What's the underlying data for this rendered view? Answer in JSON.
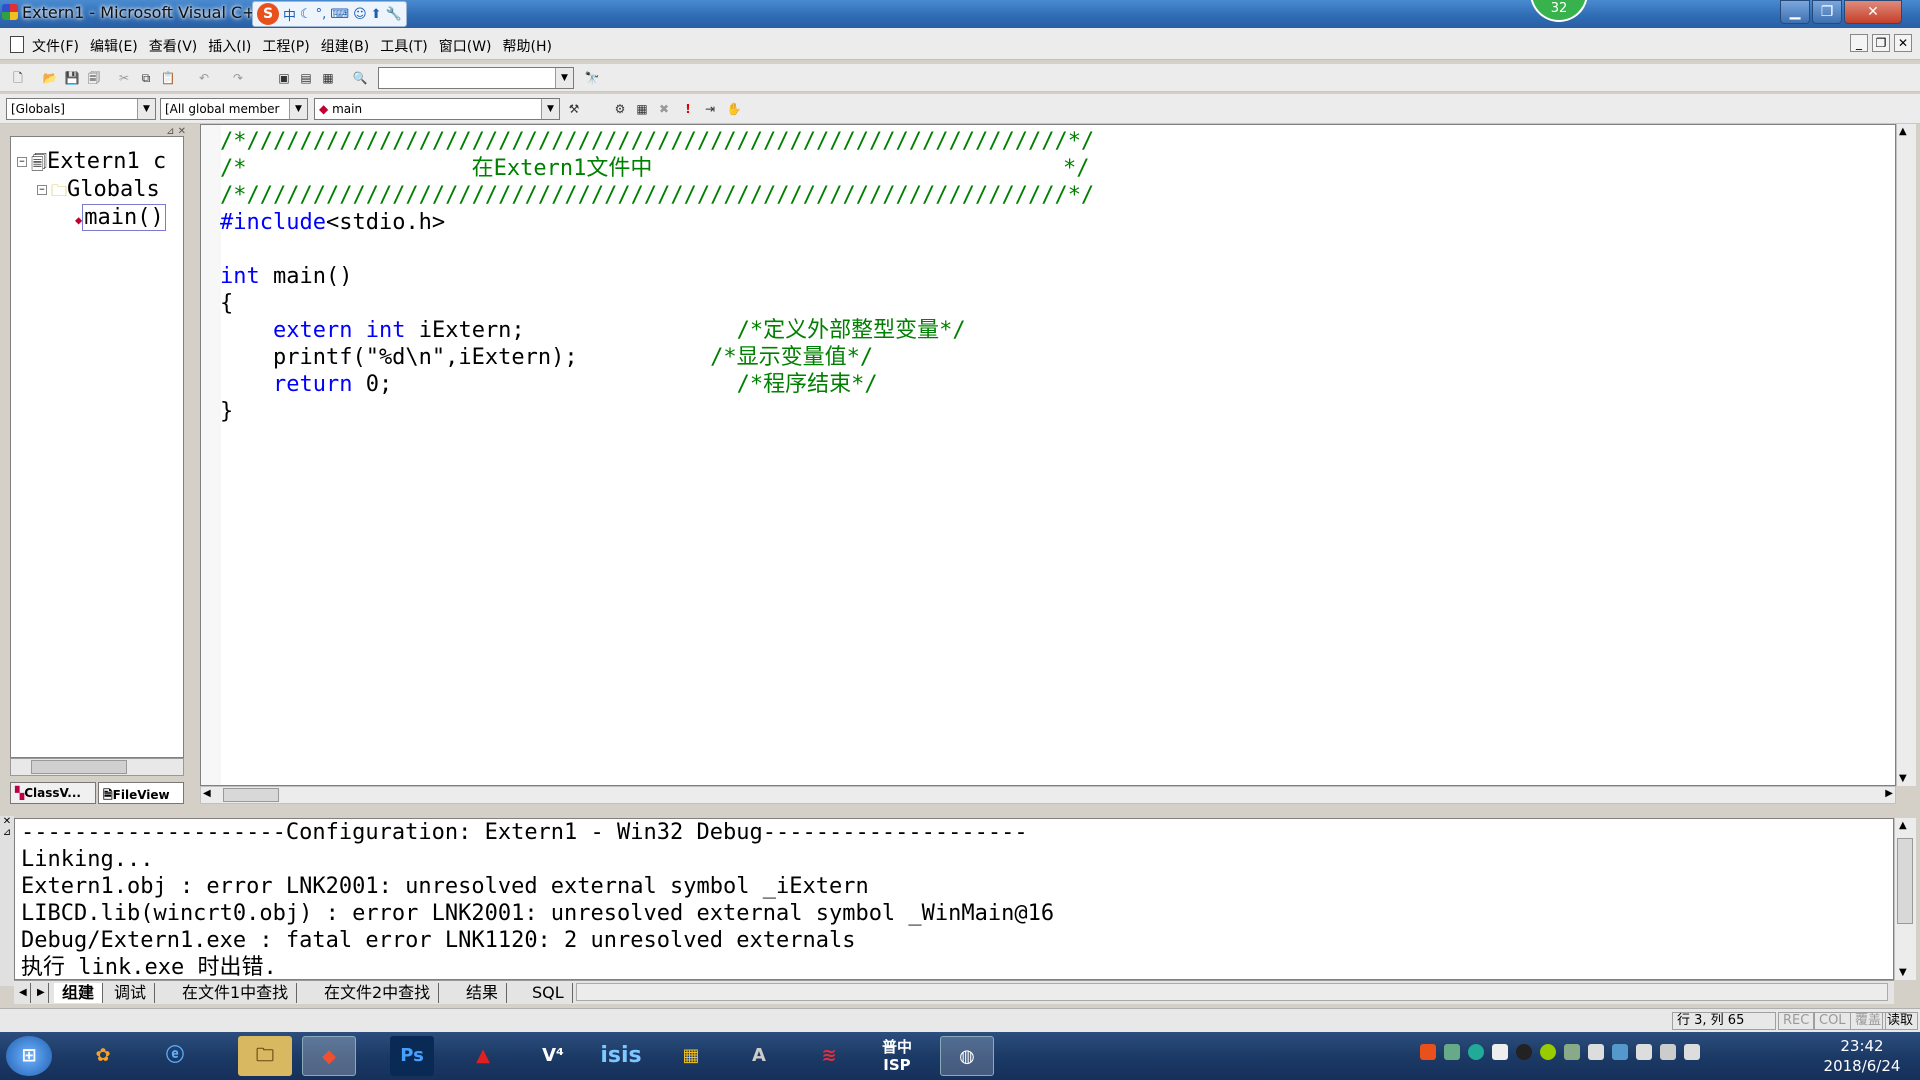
{
  "window": {
    "title": "Extern1 - Microsoft Visual C++",
    "notification_count": "32",
    "ime_toolbar": [
      "中"
    ]
  },
  "menu": [
    "文件(F)",
    "编辑(E)",
    "查看(V)",
    "插入(I)",
    "工程(P)",
    "组建(B)",
    "工具(T)",
    "窗口(W)",
    "帮助(H)"
  ],
  "wizardbar": {
    "scope": "[Globals]",
    "filter": "[All global member",
    "member": "main"
  },
  "classview": {
    "root": "Extern1 c",
    "folder": "Globals",
    "item": "main()",
    "tabs": [
      "ClassV...",
      "FileView"
    ]
  },
  "editor": {
    "lines": [
      [
        {
          "t": "/*//////////////////////////////////////////////////////////////*/",
          "c": "cm"
        }
      ],
      [
        {
          "t": "/*                 在Extern1文件中                               */",
          "c": "cm"
        }
      ],
      [
        {
          "t": "/*//////////////////////////////////////////////////////////////*/",
          "c": "cm"
        }
      ],
      [
        {
          "t": "#include",
          "c": "kw"
        },
        {
          "t": "<stdio.h>",
          "c": "tx"
        }
      ],
      [
        {
          "t": "",
          "c": "tx"
        }
      ],
      [
        {
          "t": "int",
          "c": "kw"
        },
        {
          "t": " main()",
          "c": "tx"
        }
      ],
      [
        {
          "t": "{",
          "c": "tx"
        }
      ],
      [
        {
          "t": "    ",
          "c": "tx"
        },
        {
          "t": "extern",
          "c": "kw"
        },
        {
          "t": " ",
          "c": "tx"
        },
        {
          "t": "int",
          "c": "kw"
        },
        {
          "t": " iExtern;",
          "c": "tx"
        },
        {
          "t": "                ",
          "c": "tx"
        },
        {
          "t": "/*定义外部整型变量*/",
          "c": "cm"
        }
      ],
      [
        {
          "t": "    printf(\"%d\\n\",iExtern);",
          "c": "tx"
        },
        {
          "t": "          ",
          "c": "tx"
        },
        {
          "t": "/*显示变量值*/",
          "c": "cm"
        }
      ],
      [
        {
          "t": "    ",
          "c": "tx"
        },
        {
          "t": "return",
          "c": "kw"
        },
        {
          "t": " 0;",
          "c": "tx"
        },
        {
          "t": "                          ",
          "c": "tx"
        },
        {
          "t": "/*程序结束*/",
          "c": "cm"
        }
      ],
      [
        {
          "t": "}",
          "c": "tx"
        }
      ]
    ]
  },
  "output": {
    "lines": [
      "--------------------Configuration: Extern1 - Win32 Debug--------------------",
      "Linking...",
      "Extern1.obj : error LNK2001: unresolved external symbol _iExtern",
      "LIBCD.lib(wincrt0.obj) : error LNK2001: unresolved external symbol _WinMain@16",
      "Debug/Extern1.exe : fatal error LNK1120: 2 unresolved externals",
      "执行 link.exe 时出错."
    ],
    "tabs": [
      "组建",
      "调试",
      "在文件1中查找",
      "在文件2中查找",
      "结果",
      "SQL"
    ]
  },
  "status": {
    "position": "行 3, 列 65",
    "indicators": [
      "REC",
      "COL",
      "覆盖",
      "读取"
    ]
  },
  "taskbar": {
    "apps": [
      "Ps",
      "isis",
      "普中ISP"
    ],
    "clock_time": "23:42",
    "clock_date": "2018/6/24"
  }
}
